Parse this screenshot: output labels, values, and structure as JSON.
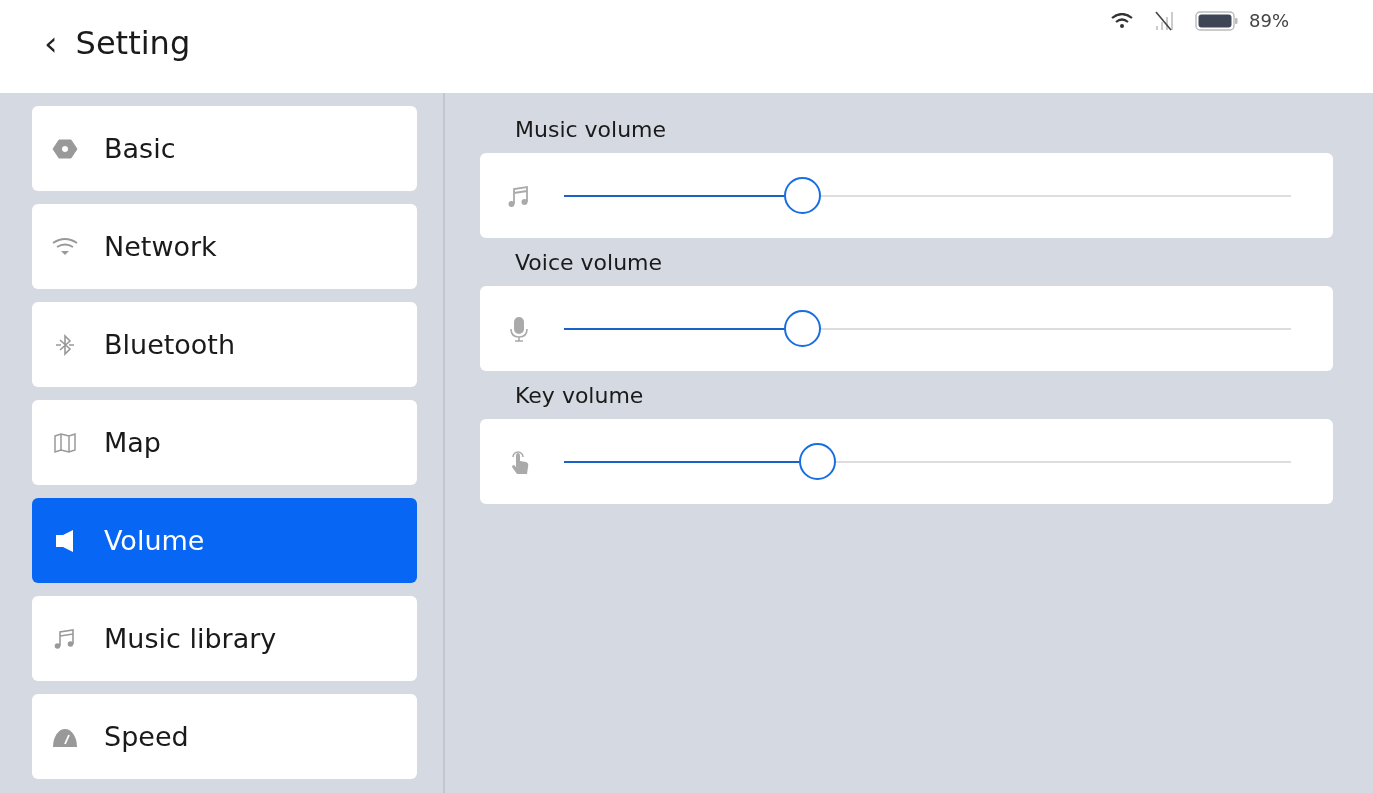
{
  "header": {
    "back": "‹",
    "title": "Setting"
  },
  "status_bar": {
    "battery": "89%"
  },
  "sidebar": {
    "items": [
      {
        "label": "Basic",
        "selected": false
      },
      {
        "label": "Network",
        "selected": false
      },
      {
        "label": "Bluetooth",
        "selected": false
      },
      {
        "label": "Map",
        "selected": false
      },
      {
        "label": "Volume",
        "selected": true
      },
      {
        "label": "Music library",
        "selected": false
      },
      {
        "label": "Speed",
        "selected": false
      }
    ]
  },
  "sliders": [
    {
      "label": "Music volume",
      "level": 0.327
    },
    {
      "label": "Voice volume",
      "level": 0.327
    },
    {
      "label": "Key volume",
      "level": 0.348
    }
  ]
}
